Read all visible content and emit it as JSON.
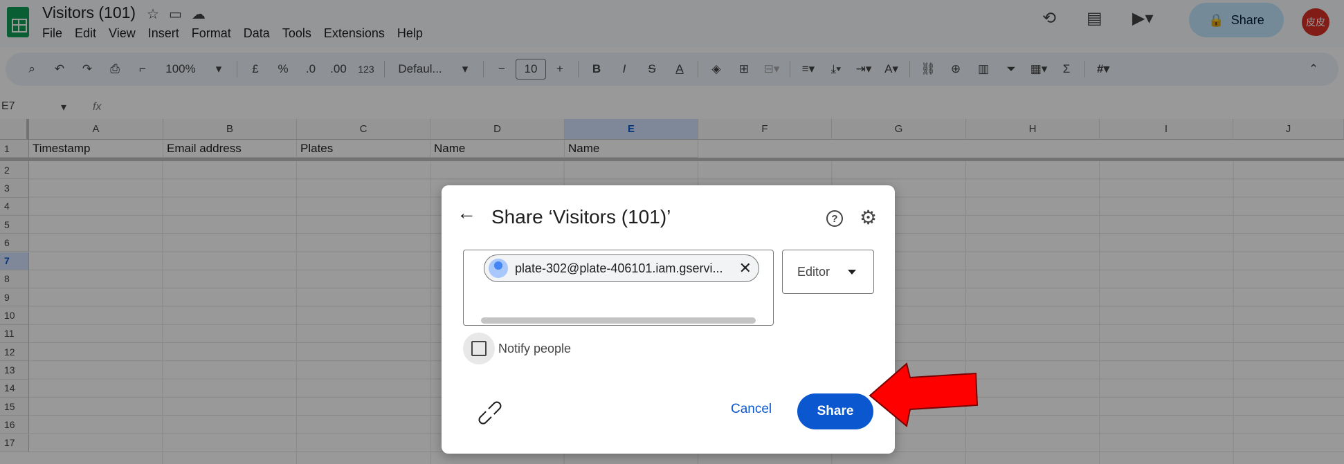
{
  "doc": {
    "title": "Visitors (101)"
  },
  "menu": [
    "File",
    "Edit",
    "View",
    "Insert",
    "Format",
    "Data",
    "Tools",
    "Extensions",
    "Help"
  ],
  "header": {
    "share_label": "Share",
    "avatar_text": "皮皮"
  },
  "toolbar": {
    "zoom": "100%",
    "currency": "£",
    "percent": "%",
    "dec_decrease": ".0",
    "dec_increase": ".00",
    "number_format": "123",
    "font": "Defaul...",
    "font_size": "10"
  },
  "formula_bar": {
    "cell_ref": "E7",
    "fx": "fx"
  },
  "sheet": {
    "columns": [
      "A",
      "B",
      "C",
      "D",
      "E",
      "F",
      "G",
      "H",
      "I",
      "J"
    ],
    "selected_column": "E",
    "rows": [
      "1",
      "2",
      "3",
      "4",
      "5",
      "6",
      "7",
      "8",
      "9",
      "10",
      "11",
      "12",
      "13",
      "14",
      "15",
      "16",
      "17"
    ],
    "selected_row": "7",
    "row1": [
      "Timestamp",
      "Email address",
      "Plates",
      "Name",
      "Name"
    ]
  },
  "dialog": {
    "title": "Share ‘Visitors (101)’",
    "recipient": "plate-302@plate-406101.iam.gservi...",
    "role": "Editor",
    "notify_label": "Notify people",
    "notify_checked": false,
    "cancel_label": "Cancel",
    "share_label": "Share"
  },
  "annotation": {
    "arrow_color": "#ff0000"
  }
}
